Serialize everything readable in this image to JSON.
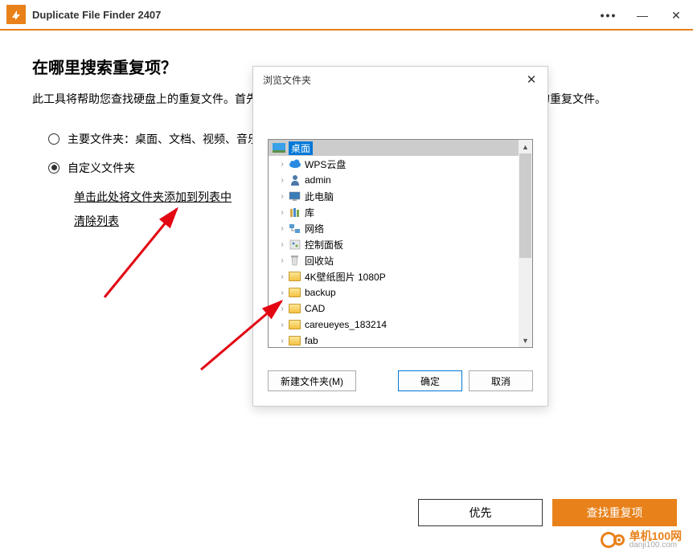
{
  "titlebar": {
    "app_title": "Duplicate File Finder 2407",
    "more": "•••",
    "minimize": "—",
    "close": "✕"
  },
  "main": {
    "heading": "在哪里搜索重复项？",
    "description": "此工具将帮助您查找硬盘上的重复文件。首先指定要扫描的位置，然后配置设置，以删除浪费磁盘空间的重复文件。",
    "option_main": "主要文件夹：桌面、文档、视频、音乐",
    "option_custom": "自定义文件夹",
    "link_add": "单击此处将文件夹添加到列表中",
    "link_clear": "清除列表"
  },
  "dialog": {
    "title": "浏览文件夹",
    "close": "✕",
    "root": "桌面",
    "tree": [
      {
        "icon": "cloud",
        "label": "WPS云盘"
      },
      {
        "icon": "user",
        "label": "admin"
      },
      {
        "icon": "pc",
        "label": "此电脑"
      },
      {
        "icon": "lib",
        "label": "库"
      },
      {
        "icon": "net",
        "label": "网络"
      },
      {
        "icon": "cp",
        "label": "控制面板"
      },
      {
        "icon": "bin",
        "label": "回收站"
      },
      {
        "icon": "folder",
        "label": "4K壁纸图片 1080P"
      },
      {
        "icon": "folder",
        "label": "backup"
      },
      {
        "icon": "folder",
        "label": "CAD"
      },
      {
        "icon": "folder",
        "label": "careueyes_183214"
      },
      {
        "icon": "folder",
        "label": "fab"
      }
    ],
    "btn_new": "新建文件夹(M)",
    "btn_ok": "确定",
    "btn_cancel": "取消"
  },
  "footer": {
    "priority": "优先",
    "find": "查找重复项"
  },
  "watermark": {
    "cn": "单机100网",
    "en": "danji100.com"
  }
}
